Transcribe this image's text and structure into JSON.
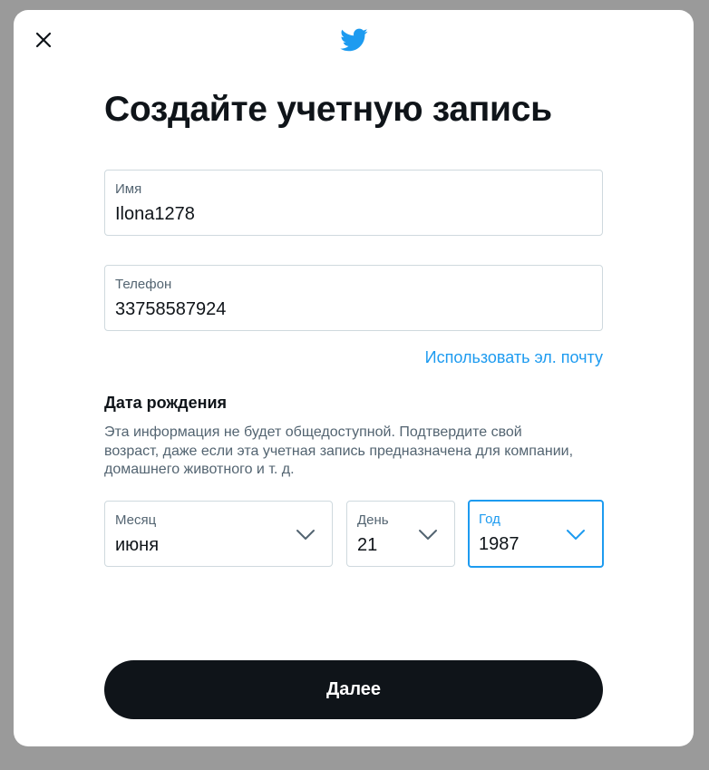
{
  "dialog": {
    "title": "Создайте учетную запись",
    "close_icon": "close-icon",
    "logo_icon": "twitter-bird-icon",
    "brand_color": "#1d9bf0"
  },
  "name_field": {
    "label": "Имя",
    "value": "Ilona1278"
  },
  "phone_field": {
    "label": "Телефон",
    "value": "33758587924"
  },
  "use_email_link": "Использовать эл. почту",
  "birthdate": {
    "title": "Дата рождения",
    "description": "Эта информация не будет общедоступной. Подтвердите свой возраст, даже если эта учетная запись предназначена для компании, домашнего животного и т. д.",
    "month": {
      "label": "Месяц",
      "value": "июня"
    },
    "day": {
      "label": "День",
      "value": "21"
    },
    "year": {
      "label": "Год",
      "value": "1987",
      "focused": true
    }
  },
  "next_button": "Далее"
}
